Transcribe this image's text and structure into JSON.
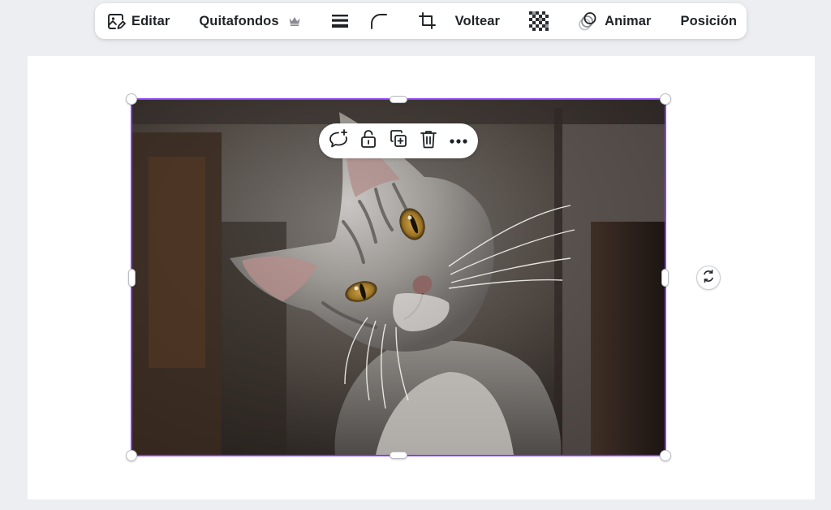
{
  "toolbar": {
    "edit_label": "Editar",
    "bg_remover_label": "Quitafondos",
    "flip_label": "Voltear",
    "animate_label": "Animar",
    "position_label": "Posición"
  },
  "icons": {
    "edit": "image-edit-icon",
    "premium": "crown-icon",
    "border_style": "border-lines-icon",
    "corner_rounding": "corner-radius-icon",
    "crop": "crop-icon",
    "transparency": "transparency-checker-icon",
    "animate": "animate-circles-icon",
    "comment": "add-comment-icon",
    "lock": "lock-icon",
    "duplicate": "duplicate-icon",
    "delete": "trash-icon",
    "more": "more-dots-icon",
    "rotate": "rotate-icon"
  },
  "colors": {
    "selection": "#8b3dff",
    "canvas": "#ffffff",
    "workspace": "#eceef1",
    "text": "#1f2226"
  }
}
